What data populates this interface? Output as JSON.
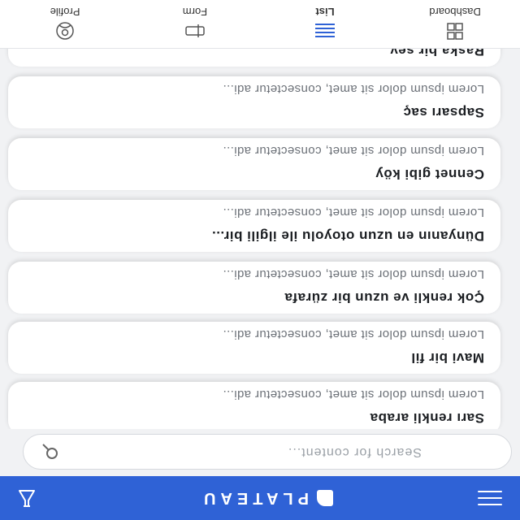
{
  "header": {
    "brand": "PLATEAU"
  },
  "search": {
    "placeholder": "Search for content..."
  },
  "list": {
    "items": [
      {
        "title": "Sarı renkli araba",
        "desc": "Lorem ipsum dolor sit amet, consectetur adi..."
      },
      {
        "title": "Mavi bir fil",
        "desc": "Lorem ipsum dolor sit amet, consectetur adi..."
      },
      {
        "title": "Çok renkli ve uzun bir zürafa",
        "desc": "Lorem ipsum dolor sit amet, consectetur adi..."
      },
      {
        "title": "Dünyanın en uzun otoyolu ile ilgili bir...",
        "desc": "Lorem ipsum dolor sit amet, consectetur adi..."
      },
      {
        "title": "Cennet gibi köy",
        "desc": "Lorem ipsum dolor sit amet, consectetur adi..."
      },
      {
        "title": "Sapsarı saç",
        "desc": "Lorem ipsum dolor sit amet, consectetur adi..."
      },
      {
        "title": "Raska bir sey",
        "desc": ""
      }
    ]
  },
  "nav": {
    "items": [
      {
        "label": "Dashboard",
        "icon": "grid-icon"
      },
      {
        "label": "List",
        "icon": "list-icon"
      },
      {
        "label": "Form",
        "icon": "form-icon"
      },
      {
        "label": "Profile",
        "icon": "profile-icon"
      }
    ],
    "active": "List"
  },
  "colors": {
    "primary": "#2f62d6",
    "active_nav": "#2f62d6"
  }
}
